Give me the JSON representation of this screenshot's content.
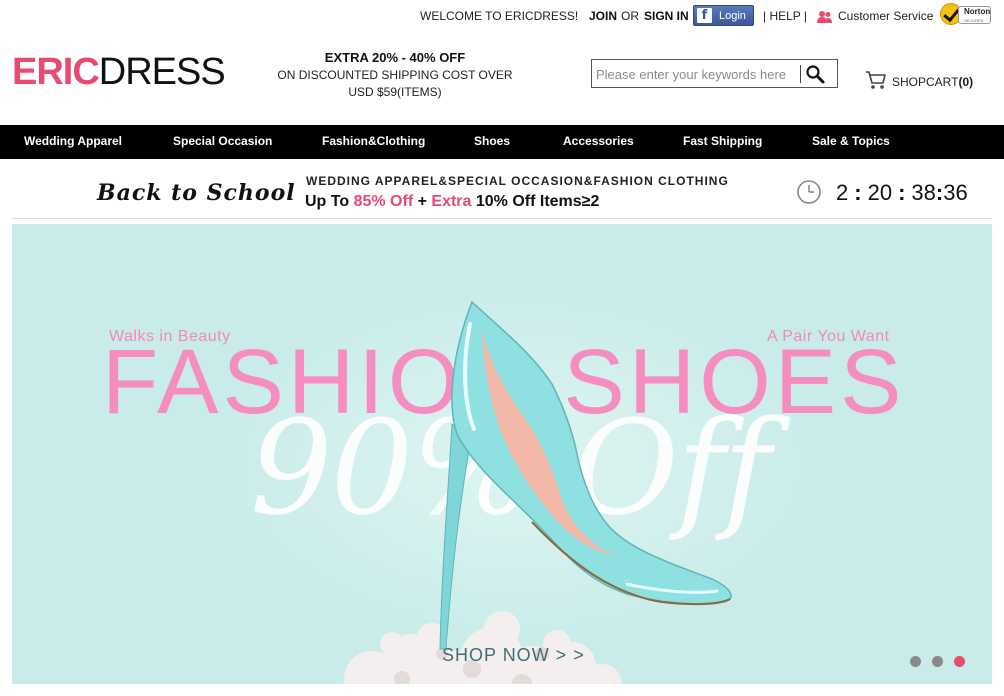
{
  "topbar": {
    "welcome": "WELCOME TO ERICDRESS!",
    "join": "JOIN",
    "or": "OR",
    "sign_in": "SIGN IN",
    "facebook_login": "Login",
    "help": "| HELP |",
    "customer_service": "Customer Service",
    "norton_badge": "Norton",
    "norton_sub": "SECURED"
  },
  "header": {
    "logo_part1": "ERIC",
    "logo_part2": "DRESS",
    "promo_line1": "EXTRA 20% - 40% OFF",
    "promo_line2": "ON DISCOUNTED SHIPPING COST OVER",
    "promo_line3": "USD $59(ITEMS)",
    "search_placeholder": "Please enter your keywords here",
    "cart_label": "SHOPCART",
    "cart_count": "(0)"
  },
  "nav": {
    "items": [
      {
        "label": "Wedding Apparel"
      },
      {
        "label": "Special Occasion"
      },
      {
        "label": "Fashion&Clothing"
      },
      {
        "label": "Shoes"
      },
      {
        "label": "Accessories"
      },
      {
        "label": "Fast Shipping"
      },
      {
        "label": "Sale & Topics"
      }
    ]
  },
  "promo_strip": {
    "title": "Back to School",
    "headline": "WEDDING APPAREL&SPECIAL OCCASION&FASHION CLOTHING",
    "offer_prefix": "Up To ",
    "offer_pct": "85% Off",
    "offer_plus": " + ",
    "offer_extra": "Extra",
    "offer_suffix": " 10% Off Items≥2",
    "countdown": {
      "days": "2",
      "hours": "20",
      "minutes": "38",
      "seconds": "36"
    }
  },
  "banner": {
    "tag_left": "Walks in Beauty",
    "tag_right": "A Pair You Want",
    "headline": "FASHION SHOES",
    "discount": "90% Off",
    "cta": "SHOP NOW > >",
    "slides": 3,
    "active_slide": 3
  },
  "colors": {
    "brand_pink": "#e84a71",
    "banner_bg": "#c9ecea",
    "title_pink": "#f58dc0",
    "nav_bg": "#000000"
  }
}
